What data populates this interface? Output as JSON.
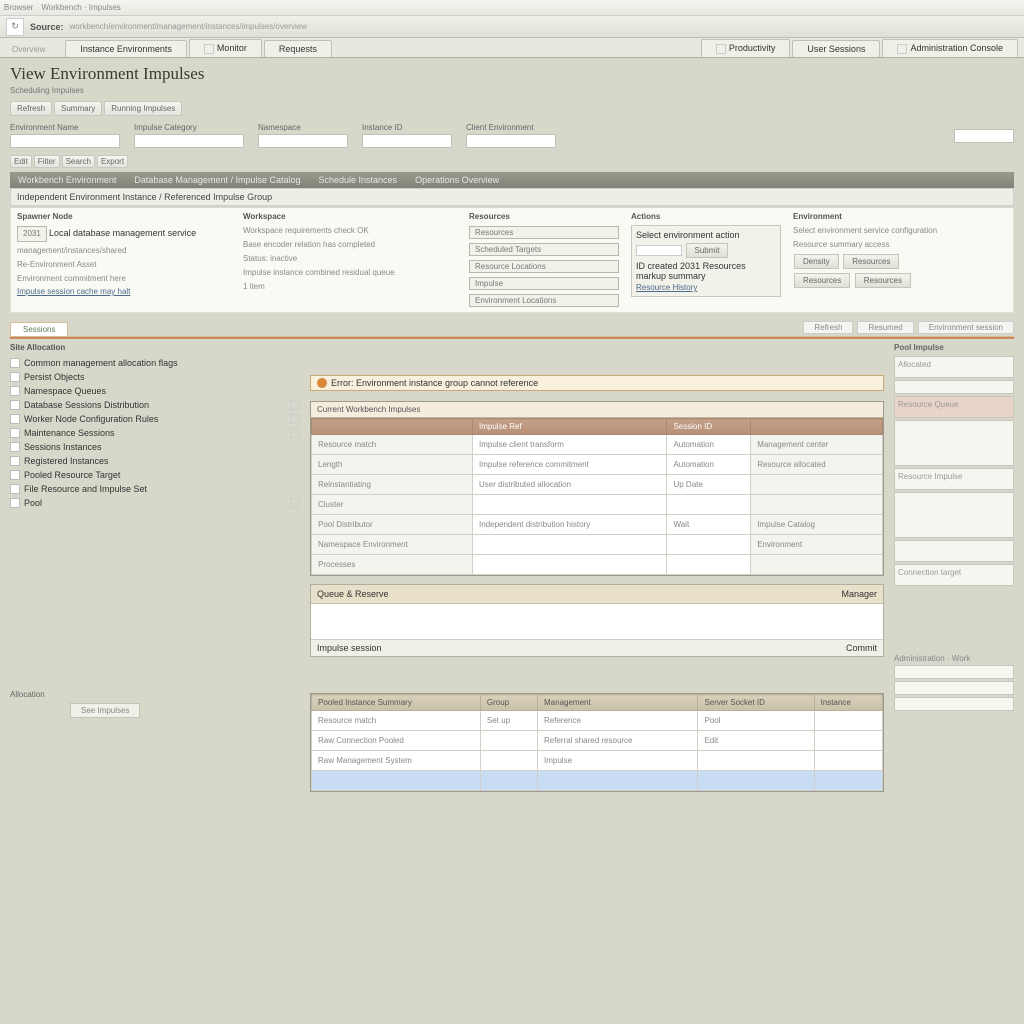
{
  "window": {
    "app_hint": "Browser",
    "tabs_hint": "Workbench · Impulses",
    "address_label": "Source:",
    "address": "workbench/environment/management/instances/impulses/overview"
  },
  "top_tabs": {
    "crumb": "Overview",
    "items": [
      "Instance Environments",
      "Monitor",
      "Requests",
      "",
      "Productivity",
      "User Sessions",
      "",
      "Administration Console"
    ]
  },
  "page_title": "View Environment Impulses",
  "page_subtitle": "Scheduling Impulses",
  "toolbar": [
    "Refresh",
    "Summary",
    "Running Impulses"
  ],
  "filters": {
    "f1_label": "Environment Name",
    "f2_label": "Impulse Category",
    "f3_label": "Namespace",
    "f4_label": "Instance ID",
    "f5_label": "Client Environment"
  },
  "small_btns": [
    "Edit",
    "Filter",
    "Search",
    "Export"
  ],
  "breadcrumb_strip": [
    "Workbench Environment",
    "Database Management / Impulse Catalog",
    "Schedule Instances",
    "Operations Overview"
  ],
  "section_header": "Independent Environment Instance / Referenced Impulse Group",
  "panels": {
    "p1": {
      "title": "Spawner Node",
      "l1": "Local database management service",
      "l2": "management/instances/shared",
      "l3": "Re-Environment Asset",
      "l4": "Environment commitment here",
      "link": "Impulse session cache may halt"
    },
    "p2": {
      "title": "Workspace",
      "l1": "Workspace requirements check OK",
      "l2": "Base encoder relation has completed",
      "l3": "Status: inactive",
      "l4": "Impulse instance combined residual queue",
      "l5": "1 item"
    },
    "p3": {
      "title": "Resources",
      "tags": [
        "Resources",
        "Scheduled Targets",
        "Resource Locations",
        "Impulse",
        "Environment Locations"
      ]
    },
    "p4": {
      "title": "Actions",
      "box_label": "Select environment action",
      "btn1": "Submit",
      "l1": "ID created",
      "l2": "2031",
      "l3": "Resources markup summary",
      "link": "Resource History"
    },
    "p5": {
      "title": "Environment",
      "l1": "Select environment service configuration",
      "l2": "Resource summary access",
      "btns": [
        "Density",
        "Resources",
        "Resources",
        "Resources"
      ]
    }
  },
  "subtab": "Sessions",
  "mini_btns": [
    "Refresh",
    "Resumed",
    "Environment session"
  ],
  "leftnav": {
    "title": "Site Allocation",
    "items": [
      "Common management allocation flags",
      "Persist Objects",
      "Namespace Queues",
      "Database Sessions Distribution",
      "Worker Node Configuration Rules",
      "Maintenance Sessions",
      "Sessions Instances",
      "Registered Instances",
      "Pooled Resource Target",
      "File Resource and Impulse Set",
      "Pool"
    ]
  },
  "main_table": {
    "caption": "Current Workbench Impulses",
    "warning": "Error: Environment instance group cannot reference",
    "headers": [
      "",
      "Impulse Ref",
      "Session ID",
      ""
    ],
    "rows": [
      [
        "Resource match",
        "Impulse client transform",
        "Automation",
        "Management center"
      ],
      [
        "Length",
        "Impulse reference commitment",
        "Automation",
        "Resource allocated"
      ],
      [
        "Reinstantiating",
        "User distributed allocation",
        "Up Date",
        ""
      ],
      [
        "Cluster",
        "",
        "",
        ""
      ],
      [
        "Pool Distributor",
        "Independent distribution history",
        "Wait",
        "Impulse Catalog"
      ],
      [
        "Namespace Environment",
        "",
        "",
        "Environment"
      ],
      [
        "Processes",
        "",
        "",
        ""
      ]
    ]
  },
  "sub_table": {
    "h1": "Queue & Reserve",
    "h2": "Manager",
    "foot1": "Impulse session",
    "foot2": "Commit"
  },
  "allocation_label": "Allocation",
  "allocation_btn": "See Impulses",
  "table3": {
    "headers": [
      "Pooled Instance Summary",
      "Group",
      "Management",
      "Server Socket ID",
      "Instance"
    ],
    "rows": [
      [
        "Resource match",
        "Set up",
        "Reference",
        "Pool",
        ""
      ],
      [
        "Raw Connection Pooled",
        "",
        "Referral shared resource",
        "Edit",
        ""
      ],
      [
        "Raw Management System",
        "",
        "Impulse",
        "",
        ""
      ],
      [
        "",
        "",
        "",
        "",
        ""
      ]
    ]
  },
  "rightcol": {
    "title": "Pool Impulse",
    "cells": [
      "Allocated",
      "",
      "Resource Queue",
      "",
      "Resource Impulse",
      "",
      "",
      "Connection target"
    ],
    "footer_label": "Administration · Work"
  }
}
